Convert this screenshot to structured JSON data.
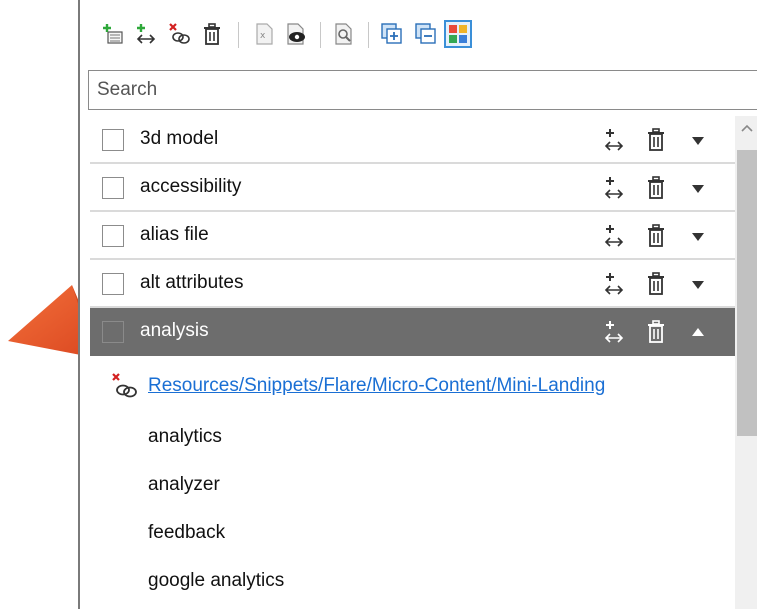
{
  "toolbar": {
    "buttons": [
      {
        "name": "add-condition-icon"
      },
      {
        "name": "link-snippet-icon"
      },
      {
        "name": "unlink-snippet-icon"
      },
      {
        "name": "delete-icon"
      },
      {
        "name": "excel-file-icon"
      },
      {
        "name": "preview-icon"
      },
      {
        "name": "find-icon"
      },
      {
        "name": "expand-all-icon"
      },
      {
        "name": "collapse-all-icon"
      },
      {
        "name": "color-grid-icon"
      }
    ]
  },
  "search": {
    "placeholder": "Search"
  },
  "terms": [
    {
      "label": "3d model",
      "expanded": false
    },
    {
      "label": "accessibility",
      "expanded": false
    },
    {
      "label": "alias file",
      "expanded": false
    },
    {
      "label": "alt attributes",
      "expanded": false
    },
    {
      "label": "analysis",
      "expanded": true,
      "selected": true
    }
  ],
  "expanded_item": {
    "link_text": "Resources/Snippets/Flare/Micro-Content/Mini-Landing",
    "subterms": [
      "analytics",
      "analyzer",
      "feedback",
      "google analytics"
    ]
  },
  "colors": {
    "selected_row": "#6d6d6d",
    "link": "#1a6fd4",
    "callout": "#e8542a",
    "active_button_border": "#3a8fd8"
  }
}
